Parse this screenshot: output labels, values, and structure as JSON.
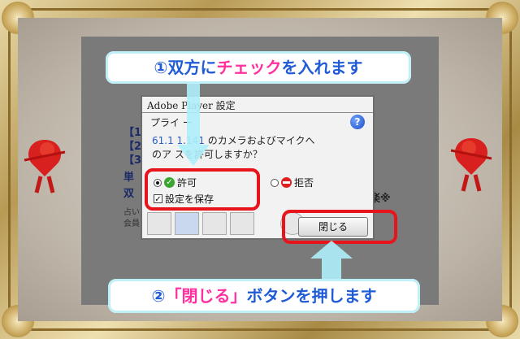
{
  "banner_top": {
    "part1": "①双方に",
    "part2": "チェック",
    "part3": "を入れます"
  },
  "banner_bottom": {
    "part1": "②",
    "part2": "「閉じる」",
    "part3": "ボタンを押します"
  },
  "background_page": {
    "lines": [
      "【1",
      "【2",
      "【3",
      "単",
      "双"
    ],
    "gray_lines": [
      "占い",
      "会員"
    ],
    "right_fragment": "楽※"
  },
  "dialog": {
    "title": "Adobe       Player 設定",
    "privacy_label": "プライ      ー",
    "help_glyph": "?",
    "message_ip": "61.1      1.141",
    "message_rest": "のカメラおよびマイクへ",
    "message_line2": "のア      スを許可しますか？",
    "allow_label": "許可",
    "deny_label": "拒否",
    "remember_label": "設定を保存",
    "allow_selected": true,
    "deny_selected": false,
    "remember_checked": true,
    "close_label": "閉じる",
    "tabs": [
      "display-tab",
      "privacy-tab",
      "storage-tab",
      "microphone-tab",
      "camera-tab"
    ]
  },
  "colors": {
    "highlight": "#e8141b",
    "arrow": "#9fe6f7",
    "text_blue": "#1f5bd6",
    "text_pink": "#ff2f9e"
  }
}
